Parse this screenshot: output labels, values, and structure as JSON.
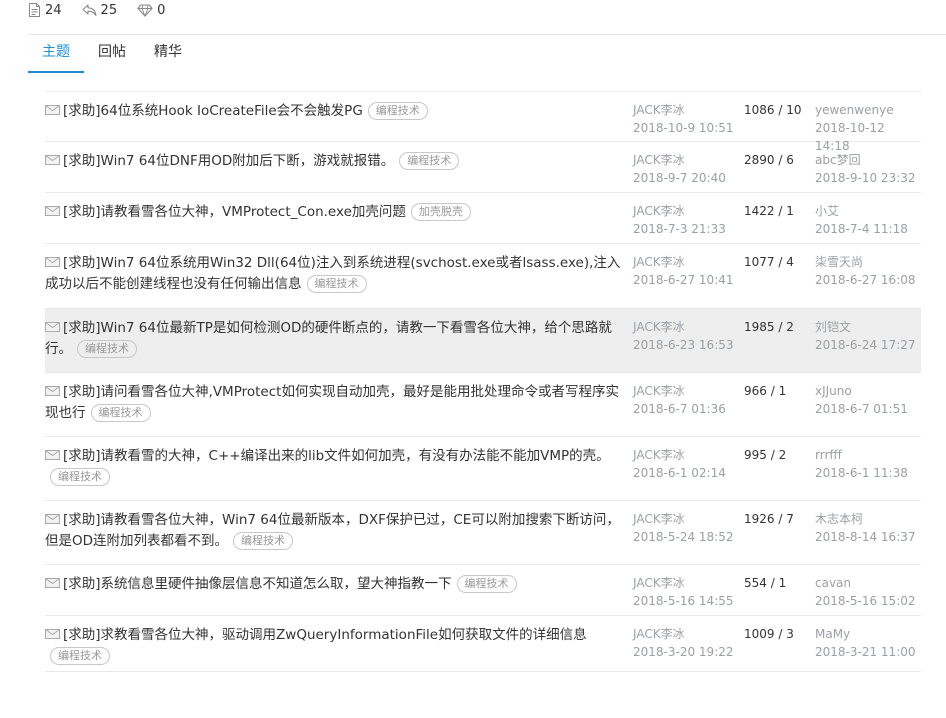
{
  "stats": {
    "topics": "24",
    "replies": "25",
    "diamonds": "0"
  },
  "tabs": [
    "主题",
    "回帖",
    "精华"
  ],
  "rows": [
    {
      "title": "[求助]64位系统Hook IoCreateFile会不会触发PG",
      "tag": "编程技术",
      "author": "JACK李冰",
      "date": "2018-10-9 10:51",
      "counts": "1086 / 10",
      "last_user": "yewenwenye",
      "last_date": "2018-10-12 14:18"
    },
    {
      "title": "[求助]Win7 64位DNF用OD附加后下断，游戏就报错。",
      "tag": "编程技术",
      "author": "JACK李冰",
      "date": "2018-9-7 20:40",
      "counts": "2890 / 6",
      "last_user": "abc梦回",
      "last_date": "2018-9-10 23:32"
    },
    {
      "title": "[求助]请教看雪各位大神，VMProtect_Con.exe加壳问题",
      "tag": "加壳脱壳",
      "author": "JACK李冰",
      "date": "2018-7-3 21:33",
      "counts": "1422 / 1",
      "last_user": "小艾",
      "last_date": "2018-7-4 11:18"
    },
    {
      "title": "[求助]Win7 64位系统用Win32 Dll(64位)注入到系统进程(svchost.exe或者lsass.exe),注入成功以后不能创建线程也没有任何输出信息",
      "tag": "编程技术",
      "author": "JACK李冰",
      "date": "2018-6-27 10:41",
      "counts": "1077 / 4",
      "last_user": "柒雪天尚",
      "last_date": "2018-6-27 16:08"
    },
    {
      "title": "[求助]Win7 64位最新TP是如何检测OD的硬件断点的，请教一下看雪各位大神，给个思路就行。",
      "tag": "编程技术",
      "author": "JACK李冰",
      "date": "2018-6-23 16:53",
      "counts": "1985 / 2",
      "last_user": "刘铠文",
      "last_date": "2018-6-24 17:27"
    },
    {
      "title": "[求助]请问看雪各位大神,VMProtect如何实现自动加壳，最好是能用批处理命令或者写程序实现也行",
      "tag": "编程技术",
      "author": "JACK李冰",
      "date": "2018-6-7 01:36",
      "counts": "966 / 1",
      "last_user": "xJJuno",
      "last_date": "2018-6-7 01:51"
    },
    {
      "title": "[求助]请教看雪的大神，C++编译出来的lib文件如何加壳，有没有办法能不能加VMP的壳。",
      "tag": "编程技术",
      "author": "JACK李冰",
      "date": "2018-6-1 02:14",
      "counts": "995 / 2",
      "last_user": "rrrfff",
      "last_date": "2018-6-1 11:38"
    },
    {
      "title": "[求助]请教看雪各位大神，Win7 64位最新版本，DXF保护已过，CE可以附加搜索下断访问，但是OD连附加列表都看不到。",
      "tag": "编程技术",
      "author": "JACK李冰",
      "date": "2018-5-24 18:52",
      "counts": "1926 / 7",
      "last_user": "木志本柯",
      "last_date": "2018-8-14 16:37"
    },
    {
      "title": "[求助]系统信息里硬件抽像层信息不知道怎么取，望大神指教一下",
      "tag": "编程技术",
      "author": "JACK李冰",
      "date": "2018-5-16 14:55",
      "counts": "554 / 1",
      "last_user": "cavan",
      "last_date": "2018-5-16 15:02"
    },
    {
      "title": "[求助]求教看雪各位大神，驱动调用ZwQueryInformationFile如何获取文件的详细信息",
      "tag": "编程技术",
      "author": "JACK李冰",
      "date": "2018-3-20 19:22",
      "counts": "1009 / 3",
      "last_user": "MaMy",
      "last_date": "2018-3-21 11:00"
    }
  ],
  "colors": {
    "accent": "#1f8fd1",
    "muted": "#9aa0a6",
    "highlight_row": "#eeeeee"
  },
  "icons": {
    "topics": "document-icon",
    "replies": "reply-arrow-icon",
    "diamonds": "diamond-icon",
    "row": "mail-icon"
  }
}
